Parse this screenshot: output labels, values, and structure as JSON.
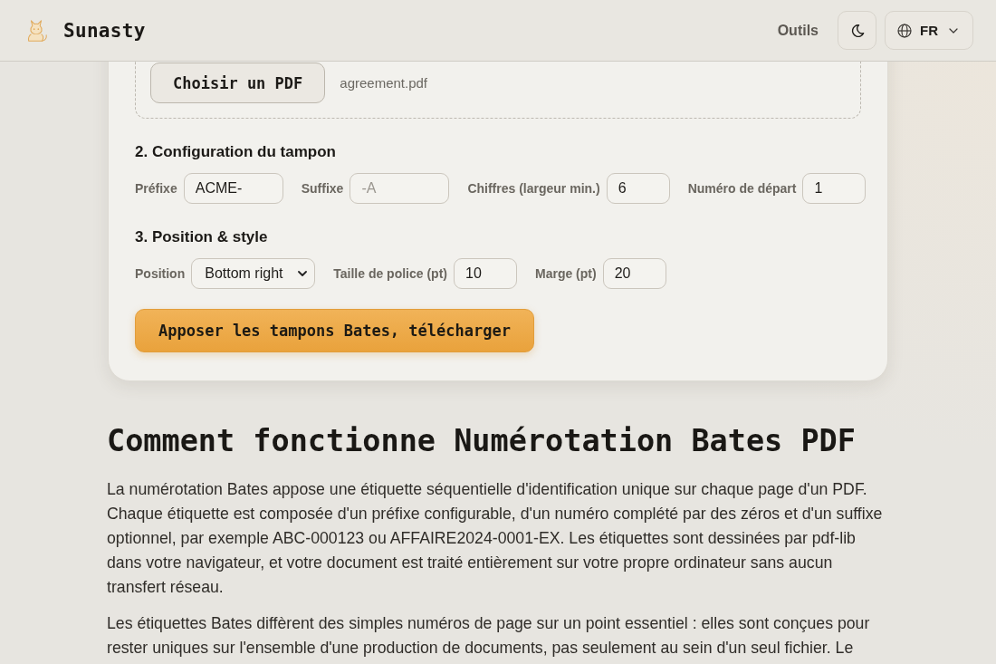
{
  "header": {
    "brand": "Sunasty",
    "nav_link": "Outils",
    "language": {
      "label": "FR"
    }
  },
  "upload": {
    "button": "Choisir un PDF",
    "file_name": "agreement.pdf"
  },
  "stamp_config": {
    "title": "2. Configuration du tampon",
    "fields": [
      {
        "kind": "text",
        "label": "Préfixe",
        "value": "ACME-"
      },
      {
        "kind": "text",
        "label": "Suffixe",
        "placeholder": "-A"
      },
      {
        "kind": "number",
        "label": "Chiffres (largeur min.)",
        "value": "6"
      },
      {
        "kind": "number",
        "label": "Numéro de départ",
        "value": "1"
      }
    ]
  },
  "position_style": {
    "title": "3. Position & style",
    "fields": [
      {
        "kind": "select",
        "label": "Position",
        "value": "Bottom right"
      },
      {
        "kind": "number",
        "label": "Taille de police (pt)",
        "value": "10"
      },
      {
        "kind": "number",
        "label": "Marge (pt)",
        "value": "20"
      }
    ]
  },
  "action_button": "Apposer les tampons Bates, télécharger",
  "article": {
    "title": "Comment fonctionne Numérotation Bates PDF",
    "paragraphs": [
      "La numérotation Bates appose une étiquette séquentielle d'identification unique sur chaque page d'un PDF. Chaque étiquette est composée d'un préfixe configurable, d'un numéro complété par des zéros et d'un suffixe optionnel, par exemple ABC-000123 ou AFFAIRE2024-0001-EX. Les étiquettes sont dessinées par pdf-lib dans votre navigateur, et votre document est traité entièrement sur votre propre ordinateur sans aucun transfert réseau.",
      "Les étiquettes Bates diffèrent des simples numéros de page sur un point essentiel : elles sont conçues pour rester uniques sur l'ensemble d'une production de documents, pas seulement au sein d'un seul fichier. Le"
    ]
  }
}
